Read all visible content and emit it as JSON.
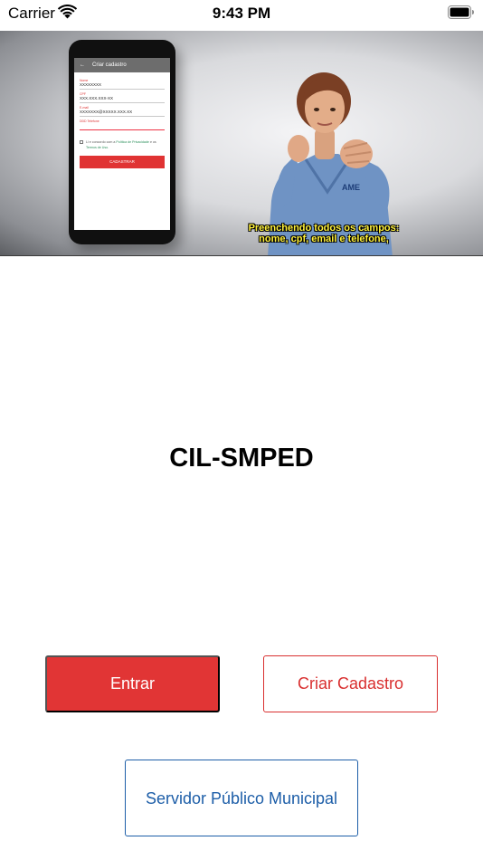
{
  "status_bar": {
    "carrier": "Carrier",
    "time": "9:43 PM"
  },
  "video": {
    "phone_screen": {
      "header_title": "Criar cadastro",
      "fields": [
        {
          "label": "Nome",
          "value": "XXXXXXXX"
        },
        {
          "label": "CPF",
          "value": "XXX.XXX.XXX-XX"
        },
        {
          "label": "E-mail",
          "value": "XXXXXXX@XXXXX.XXX.XX"
        },
        {
          "label": "DDD Telefone",
          "value": ""
        }
      ],
      "consent_prefix": "Li e concordo com a",
      "consent_link_1": "Política de Privacidade",
      "consent_middle": "e os",
      "consent_link_2": "Termos de Uso.",
      "submit_label": "CADASTRAR"
    },
    "shirt_logo": "AME",
    "subtitle_line_1": "Preenchendo todos os campos:",
    "subtitle_line_2": "nome, cpf, email e  telefone,"
  },
  "title": "CIL-SMPED",
  "buttons": {
    "enter": "Entrar",
    "register": "Criar Cadastro",
    "server": "Servidor Público Municipal"
  },
  "colors": {
    "primary_red": "#e13535",
    "primary_blue": "#1d5ea8"
  }
}
